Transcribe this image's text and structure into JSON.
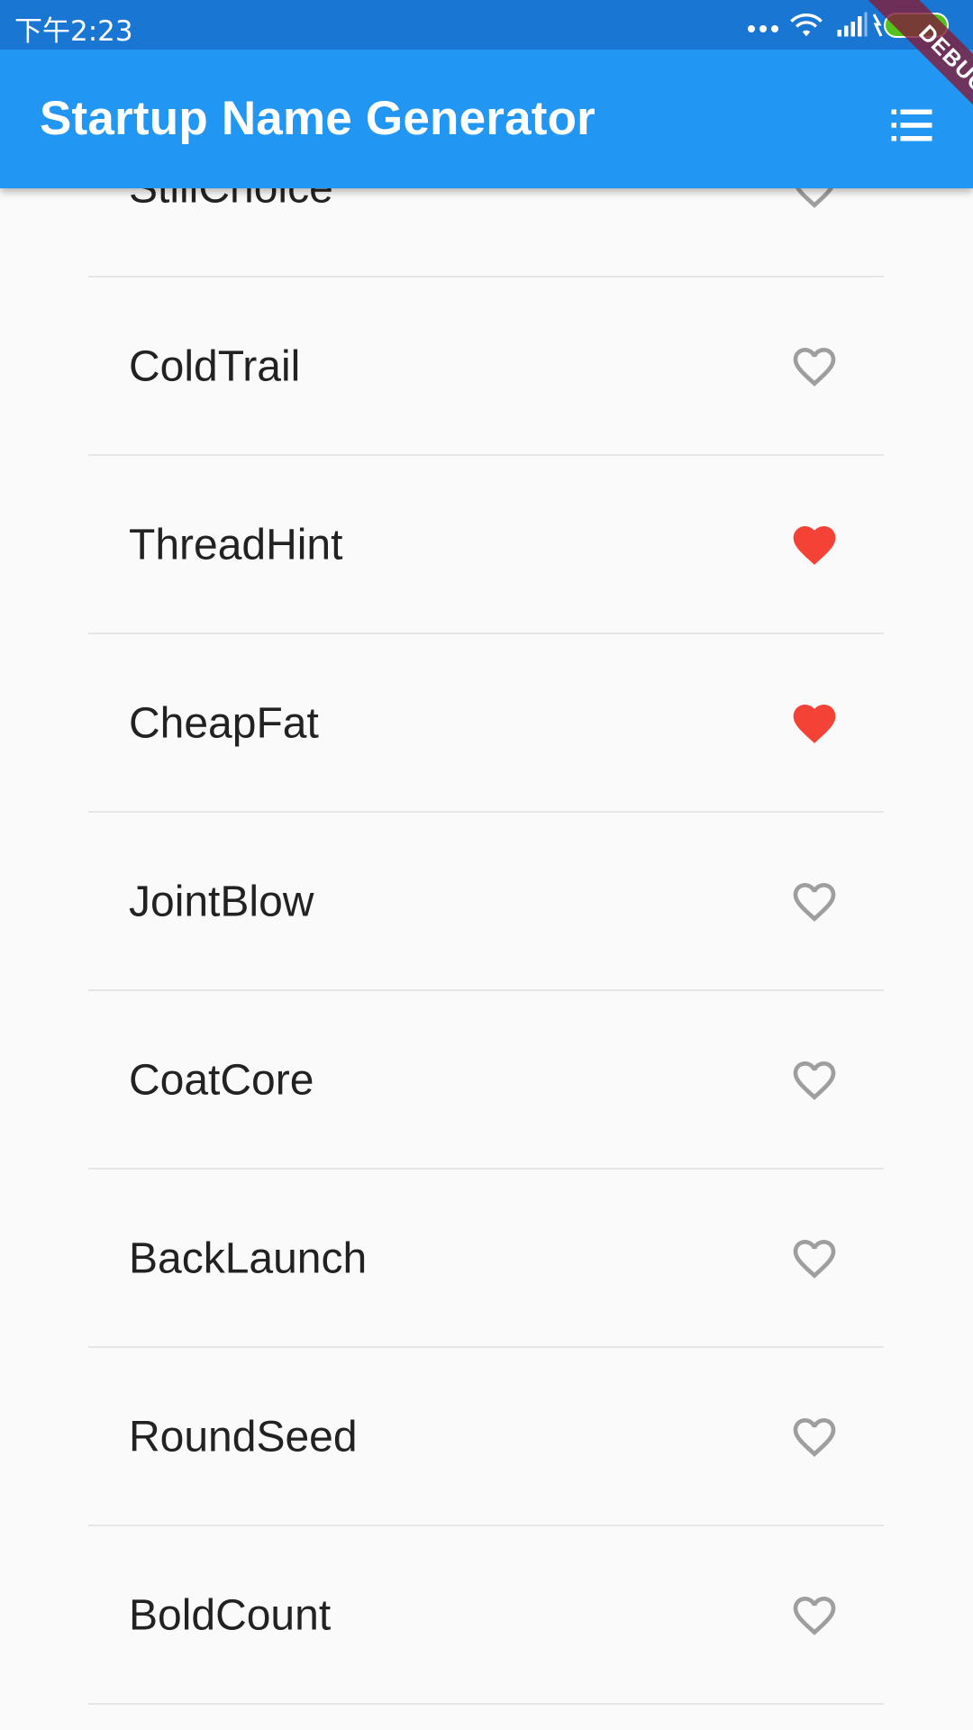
{
  "status_bar": {
    "time": "下午2:23"
  },
  "app_bar": {
    "title": "Startup Name Generator",
    "action_icon": "list-icon"
  },
  "debug_banner": "DEBUG",
  "colors": {
    "status_bar": "#1976d2",
    "app_bar": "#2196f3",
    "favorite": "#f44336",
    "not_favorite": "#9e9e9e"
  },
  "rows": [
    {
      "name": "StillChoice",
      "saved": false
    },
    {
      "name": "ColdTrail",
      "saved": false
    },
    {
      "name": "ThreadHint",
      "saved": true
    },
    {
      "name": "CheapFat",
      "saved": true
    },
    {
      "name": "JointBlow",
      "saved": false
    },
    {
      "name": "CoatCore",
      "saved": false
    },
    {
      "name": "BackLaunch",
      "saved": false
    },
    {
      "name": "RoundSeed",
      "saved": false
    },
    {
      "name": "BoldCount",
      "saved": false
    }
  ]
}
